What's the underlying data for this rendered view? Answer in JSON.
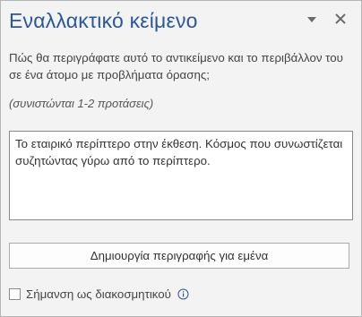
{
  "pane": {
    "title": "Εναλλακτικό κείμενο",
    "question": "Πώς θα περιγράφατε αυτό το αντικείμενο και το περιβάλλον του σε ένα άτομο με προβλήματα όρασης;",
    "hint": "(συνιστώνται 1-2 προτάσεις)",
    "alt_text_value": "Το εταιρικό περίπτερο στην έκθεση. Κόσμος που συνωστίζεται συζητώντας γύρω από το περίπτερο.",
    "generate_button_label": "Δημιουργία περιγραφής για εμένα",
    "decorative_checkbox_label": "Σήμανση ως διακοσμητικού",
    "decorative_checked": false
  },
  "icons": {
    "collapse": "chevron-down-icon",
    "close": "close-icon",
    "info": "info-icon"
  },
  "colors": {
    "title": "#2b579a",
    "pane_background": "#f3f3f3",
    "info_icon": "#2b579a"
  }
}
